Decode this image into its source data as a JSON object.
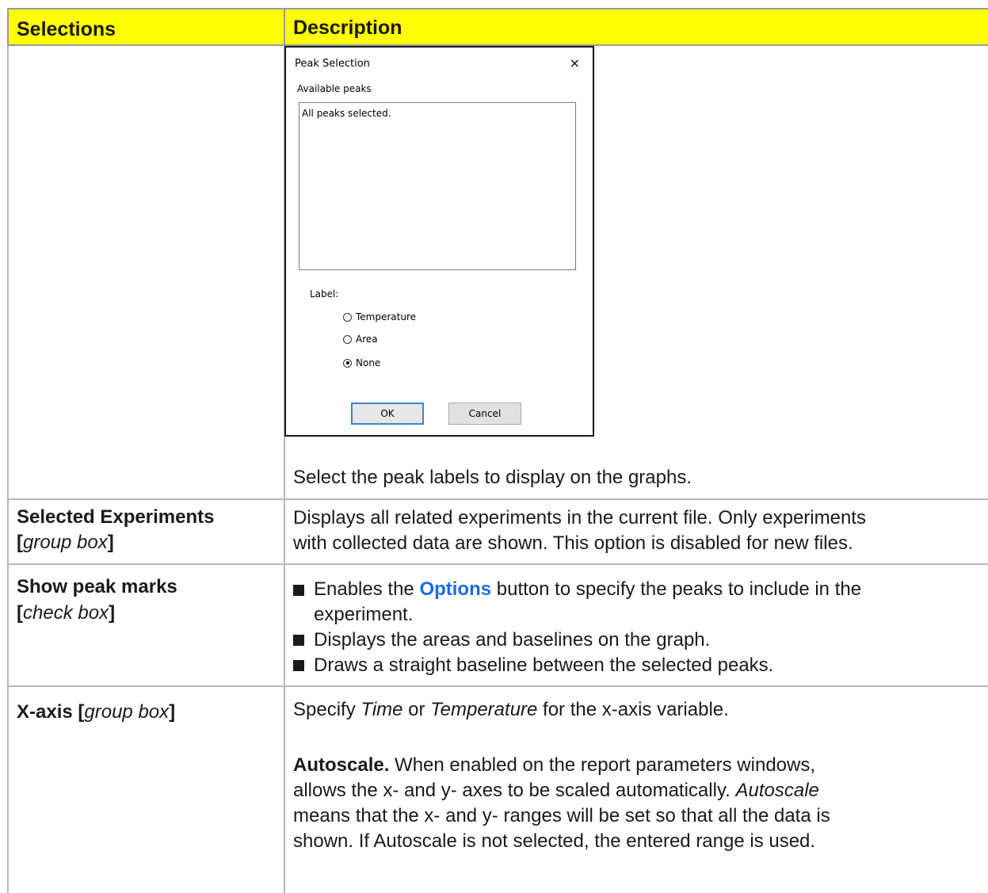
{
  "header": {
    "col1": "Selections",
    "col2": "Description"
  },
  "dialog": {
    "title": "Peak Selection",
    "close": "×",
    "available_label": "Available peaks",
    "list_text": "All peaks selected.",
    "label_caption": "Label:",
    "radios": [
      {
        "label": "Temperature",
        "selected": false
      },
      {
        "label": "Area",
        "selected": false
      },
      {
        "label": "None",
        "selected": true
      }
    ],
    "ok": "OK",
    "cancel": "Cancel"
  },
  "row1": {
    "desc": "Select the peak labels to display on the graphs."
  },
  "row2": {
    "title": "Selected Experiments",
    "type_open": "[",
    "type": "group box",
    "type_close": "]",
    "desc_line1": "Displays all related experiments in the current file. Only experiments",
    "desc_line2": "with collected data are shown. This option is disabled for new files."
  },
  "row3": {
    "title": "Show peak marks",
    "type_open": "[",
    "type": "check box",
    "type_close": "]",
    "bullet1_pre": "Enables the ",
    "bullet1_link": "Options",
    "bullet1_post": " button to specify the peaks to include in the",
    "bullet1_cont": "experiment.",
    "bullet2": "Displays the areas and baselines on the graph.",
    "bullet3": "Draws a straight baseline between the selected peaks."
  },
  "row4": {
    "title": "X-axis",
    "type_open": " [",
    "type": "group box",
    "type_close": "]",
    "p1_pre": "Specify ",
    "p1_time": "Time",
    "p1_or": " or ",
    "p1_temp": "Temperature",
    "p1_post": " for the x-axis variable.",
    "p2_bold": "Autoscale.",
    "p2_line1": " When enabled on the report parameters windows,",
    "p2_line2_pre": "allows the x- and y- axes to be scaled automatically. ",
    "p2_line2_ital": "Autoscale",
    "p2_line3": "means that the x- and y- ranges will be set so that all the data is",
    "p2_line4": "shown. If Autoscale is not selected, the entered range is used."
  }
}
